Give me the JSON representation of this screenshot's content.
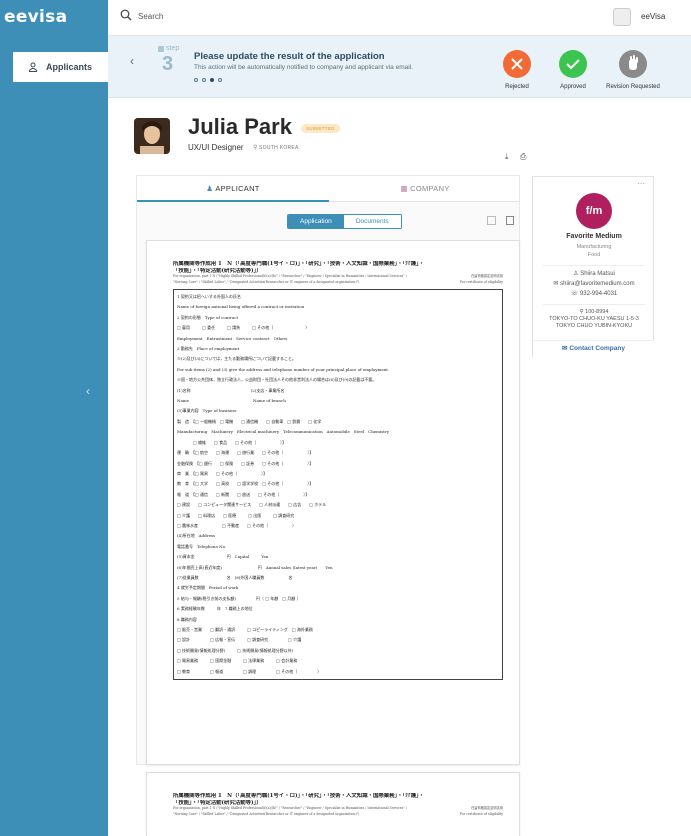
{
  "app": {
    "brand": "eevisa"
  },
  "sidebar": {
    "items": [
      {
        "label": "Applicants",
        "icon": "users-icon"
      }
    ]
  },
  "topbar": {
    "search_placeholder": "Search",
    "user": "eeVisa"
  },
  "banner": {
    "step_word": "step",
    "step_number": "3",
    "title": "Please update the result of the application",
    "subtitle": "This action will be automatically notified to company and applicant via email.",
    "steps_total": 4,
    "current_step_index": 3,
    "actions": [
      {
        "label": "Rejected",
        "color": "#f26a35"
      },
      {
        "label": "Approved",
        "color": "#3cc451"
      },
      {
        "label": "Revision Requested",
        "color": "#8a8a8a"
      }
    ]
  },
  "profile": {
    "name": "Julia Park",
    "status": "SUBMITTED",
    "role": "UX/UI Designer",
    "location": "SOUTH KOREA"
  },
  "tabs": [
    {
      "label": "APPLICANT"
    },
    {
      "label": "COMPANY"
    }
  ],
  "doc_toggle": {
    "application": "Application",
    "documents": "Documents"
  },
  "company": {
    "logo_text": "f/m",
    "logo_color": "#b0205f",
    "name": "Favorite Medium",
    "industry": "Manufacturing",
    "sub_industry": "Food",
    "contact_name": "Shiira Matsui",
    "email": "shiira@favoritemedium.com",
    "phone": "932-994-4031",
    "postal": "100-8994",
    "address_1": "TOKYO-TO CHUO-KU YAESU 1-5-3",
    "address_2": "TOKYO CHUO YUBIN-KYOKU",
    "contact_button": "Contact Company"
  },
  "document": {
    "heading": "所属機関等作成用 1　N（「高度専門職(1号イ・ロ)」・「研究」・「技術・人文知識・国際業務」・「介護」・",
    "heading2": "「技能」・「特定活動(研究活動等)」）",
    "sub1": "For organization, part 1 N (\"Highly Skilled Professional(i)(a)/(b)\" / \"Researcher\" / \"Engineer / Specialist in Humanities / International Services\" / ",
    "sub1_right": "在留資格認定証明書用",
    "sub2": "\"Nursing Care\" / \"Skilled Labor\" / \"Designated Activities(Researcher or IT engineer of a designated organization)\")",
    "sub2_right": "For certificate of eligibility",
    "lines": [
      "1 契約又は招へいする外国人の氏名",
      "Name of foreign national being offered a contract or invitation",
      "2 契約の形態　Type of contract",
      "□ 雇用　　　□ 委任　　　□ 請負　　　□ その他（　　　　　　　　）",
      "Employment　Entrustment　Service contract　Others",
      "3 勤務先　Place of employment",
      "※(2)及び(3)については，主たる勤務場所について記載すること。",
      "For sub-items (2) and (3) give the address and telephone number of your principal place of employment.",
      "※国・地方公共団体，独立行政法人，公益財団・社団法人その他非営利法人の場合は(6)及び(9)の記載は不要。",
      "(1)名称　　　　　　　　　　　　　　　(2)支店・事業所名",
      "Name　　　　　　　　　　　　　　　　Name of branch",
      "(3)事業内容　Type of business",
      "製　造　【□ 一般機械　□ 電機　　□ 通信機　　□ 自動車　□ 鉄鋼　　□ 化学",
      "Manufacturing　Machinery　Electrical machinery　Telecommunication　Automobile　Steel　Chemistry",
      "　　　　□ 繊維　　□ 食品　　□ その他（　　　　　　）】",
      "運　輸　【□ 航空　　□ 海運　　□ 旅行業　　□ その他（　　　　　　）】",
      "金融保険　【□ 銀行　　□ 保険　　□ 証券　　□ その他（　　　　　　）】",
      "商　業　【□ 貿易　　□ その他（　　　　　　）】",
      "教　育　【□ 大学　　□ 高校　　□ 語学学校　□ その他（　　　　　　）】",
      "報　道　【□ 通信　　□ 新聞　　□ 放送　　□ その他（　　　　　　）】",
      "□ 建設　　□ コンピュータ関連サービス　　□ 人材派遣　　□ 広告　　□ ホテル",
      "□ 介護　　□ 料理店　　□ 医療　　　□ 出版　　　□ 調査研究",
      "□ 農林水産　　　　　　□ 不動産　　□ その他（　　　　　　）",
      "(4)所在地　Address",
      "電話番号　Telephone No.",
      "(5)資本金　　　　　　　　円　Capital　　　Yen",
      "(6)年間売上高(直近年度)　　　　　　　　　円　Annual sales (latest year)　　Yen",
      "(7)従業員数　　　　　　　名　(8)外国人職員数　　　　　　名",
      "4 就労予定期間　Period of work",
      "5 給与・報酬(税引き前の支払額)　　　　　円（ □ 年額　□ 月額 ）",
      "6 実務経験年数　　　年　7 職務上の地位",
      "8 職務内容",
      "□ 販売・営業　　□ 翻訳・通訳　　　□ コピーライティング　□ 海外業務",
      "□ 設計　　　　　□ 広報・宣伝　　　□ 調査研究　　　　　□ 介護",
      "□ 技術開発(情報処理分野)　　　□ 技術開発(情報処理分野以外)",
      "□ 貿易業務　　　□ 国際金融　　　□ 法律業務　　　□ 会計業務",
      "□ 教育　　　　　□ 報道　　　　　□ 調理　　　　　□ その他（　　　　　）"
    ]
  }
}
